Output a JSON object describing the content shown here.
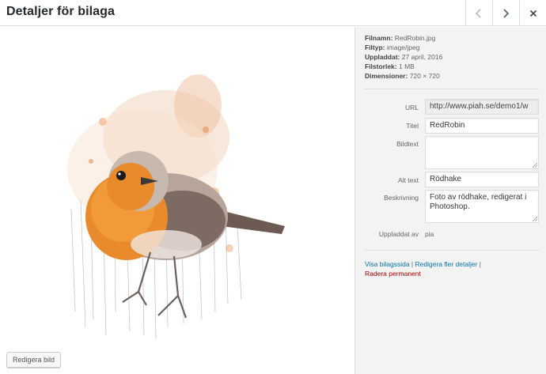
{
  "header": {
    "title": "Detaljer för bilaga"
  },
  "meta": {
    "filename_label": "Filnamn:",
    "filename": "RedRobin.jpg",
    "filetype_label": "Filtyp:",
    "filetype": "image/jpeg",
    "uploaded_label": "Uppladdat:",
    "uploaded": "27 april, 2016",
    "filesize_label": "Filstorlek:",
    "filesize": "1 MB",
    "dimensions_label": "Dimensioner:",
    "dimensions": "720 × 720"
  },
  "form": {
    "url_label": "URL",
    "url_value": "http://www.piah.se/demo1/w",
    "title_label": "Titel",
    "title_value": "RedRobin",
    "caption_label": "Bildtext",
    "caption_value": "",
    "alt_label": "Alt text",
    "alt_value": "Rödhake",
    "description_label": "Beskrivning",
    "description_value": "Foto av rödhake, redigerat i Photoshop.",
    "uploaded_by_label": "Uppladdat av",
    "uploaded_by_value": "pia"
  },
  "actions": {
    "view_page": "Visa bilagssida",
    "edit_more": "Redigera fler detaljer",
    "delete": "Radera permanent",
    "separator": "|"
  },
  "left": {
    "edit_image_button": "Redigera bild"
  },
  "icons": {
    "prev": "chevron-left-icon",
    "next": "chevron-right-icon",
    "close": "close-icon"
  },
  "colors": {
    "link": "#0073aa",
    "delete_link": "#aa0000",
    "sidebar_bg": "#f3f3f3"
  }
}
